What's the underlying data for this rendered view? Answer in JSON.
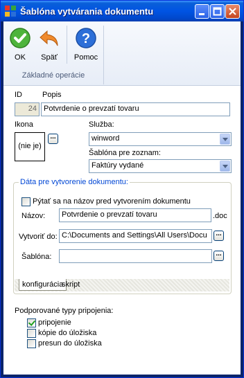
{
  "window": {
    "title": "Šablóna vytvárania dokumentu"
  },
  "ribbon": {
    "ok_label": "OK",
    "back_label": "Späť",
    "help_label": "Pomoc",
    "group_label": "Základné operácie"
  },
  "form": {
    "id_label": "ID",
    "id_value": "24",
    "popis_label": "Popis",
    "popis_value": "Potvrdenie o prevzatí tovaru",
    "ikona_label": "Ikona",
    "ikona_value": "(nie je)",
    "sluzba_label": "Služba:",
    "sluzba_value": "winword",
    "sablona_zoznam_label": "Šablóna pre zoznam:",
    "sablona_zoznam_value": "Faktúry vydané"
  },
  "data_group": {
    "title": "Dáta pre vytvorenie dokumentu:",
    "ask_name_label": "Pýtať sa na názov pred vytvorením dokumentu",
    "ask_name_checked": false,
    "nazov_label": "Názov:",
    "nazov_value": "Potvrdenie o prevzatí tovaru",
    "nazov_ext": ".doc",
    "vytvorit_label": "Vytvoriť do:",
    "vytvorit_value": "C:\\Documents and Settings\\All Users\\Docu",
    "sablona_label": "Šablóna:",
    "sablona_value": ""
  },
  "tabs": [
    {
      "label": "konfigurácia",
      "active": true
    },
    {
      "label": "skript",
      "active": false
    }
  ],
  "connections": {
    "title": "Podporované typy pripojenia:",
    "items": [
      {
        "label": "pripojenie",
        "checked": true
      },
      {
        "label": "kópie do úložiska",
        "checked": false
      },
      {
        "label": "presun do úložiska",
        "checked": false
      }
    ]
  }
}
